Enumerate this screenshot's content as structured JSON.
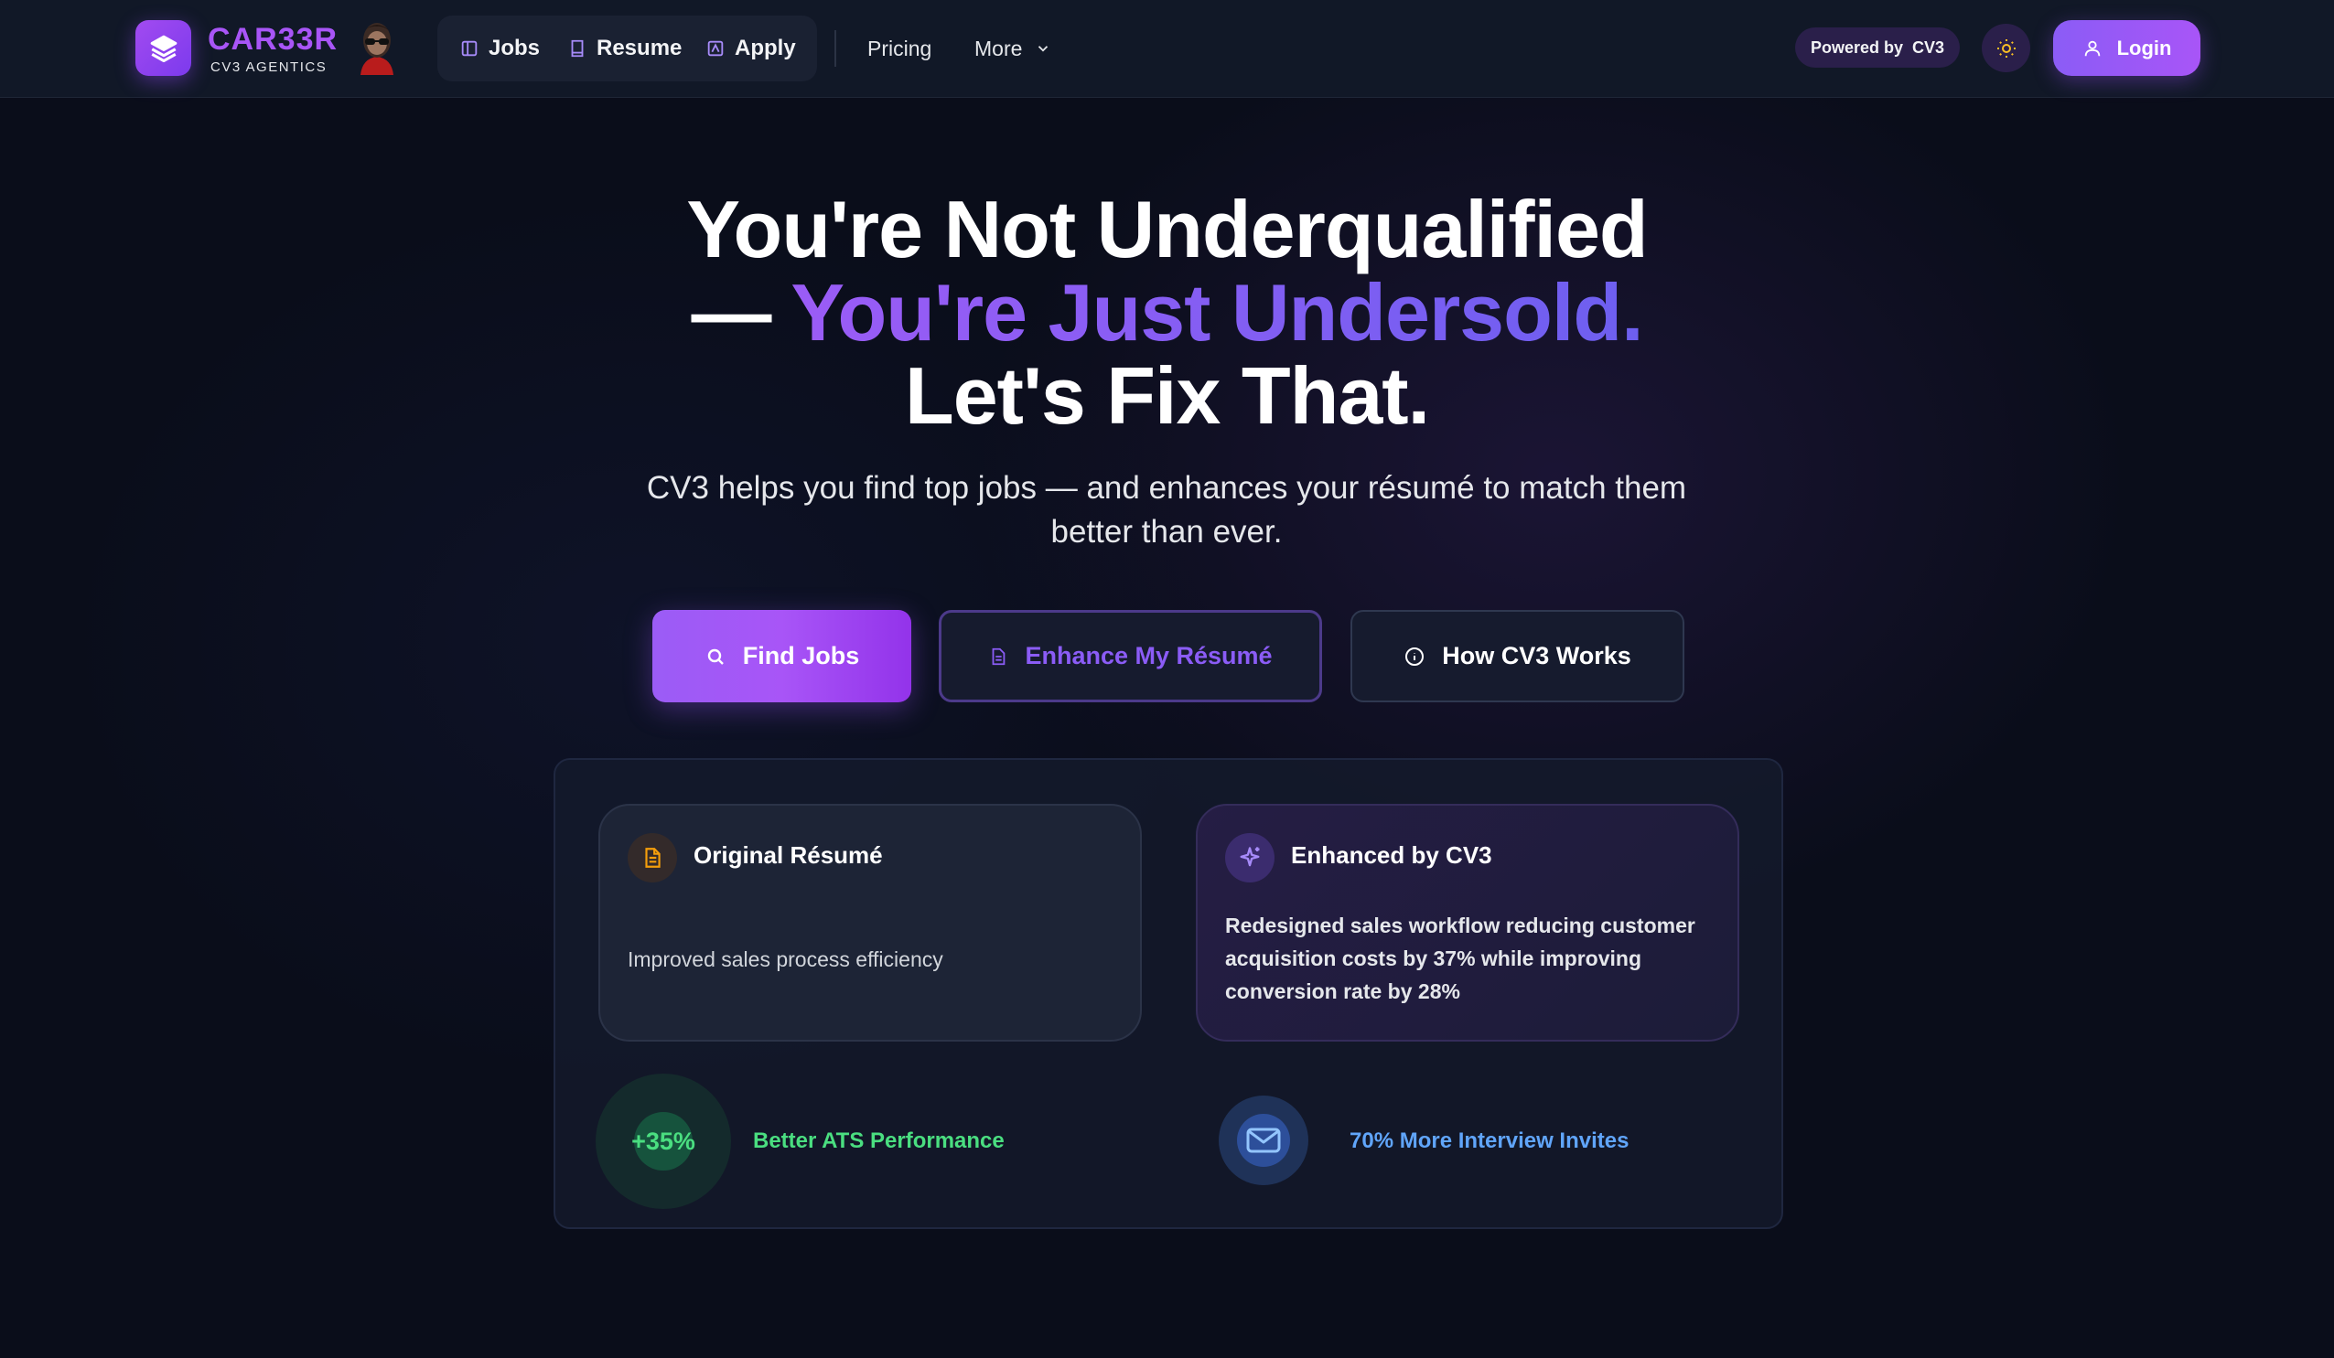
{
  "header": {
    "brand": {
      "name": "CAR33R",
      "subtitle": "CV3 AGENTICS",
      "logo_icon": "layers-icon",
      "avatar_icon": "avatar-icon"
    },
    "nav_primary": [
      {
        "label": "Jobs",
        "icon": "book-open-icon"
      },
      {
        "label": "Resume",
        "icon": "book-icon"
      },
      {
        "label": "Apply",
        "icon": "image-box-icon"
      }
    ],
    "nav_secondary": {
      "pricing": "Pricing",
      "more": "More"
    },
    "powered_by": {
      "prefix": "Powered by",
      "name": "CV3"
    },
    "theme_toggle_icon": "sun-icon",
    "login_label": "Login"
  },
  "hero": {
    "title_line1": "You're Not Underqualified",
    "title_dash": "— ",
    "title_accent": "You're Just Undersold.",
    "title_line3": "Let's Fix That.",
    "subtitle": "CV3 helps you find top jobs — and enhances your résumé to match them better than ever."
  },
  "actions": {
    "find_jobs": "Find Jobs",
    "enhance_resume": "Enhance My Résumé",
    "how_it_works": "How CV3 Works"
  },
  "comparison": {
    "original": {
      "title": "Original Résumé",
      "text": "Improved sales process efficiency",
      "icon": "document-icon"
    },
    "enhanced": {
      "title": "Enhanced by CV3",
      "text": "Redesigned sales workflow reducing customer acquisition costs by 37% while improving conversion rate by 28%",
      "icon": "sparkles-icon"
    },
    "stats": [
      {
        "value": "+35%",
        "label": "Better ATS Performance",
        "color": "#4ade80"
      },
      {
        "label": "70% More Interview Invites",
        "color": "#60a5fa",
        "icon": "mail-icon"
      }
    ]
  },
  "colors": {
    "accent": "#8b5cf6",
    "background": "#0a0d1a",
    "header": "#111827"
  }
}
